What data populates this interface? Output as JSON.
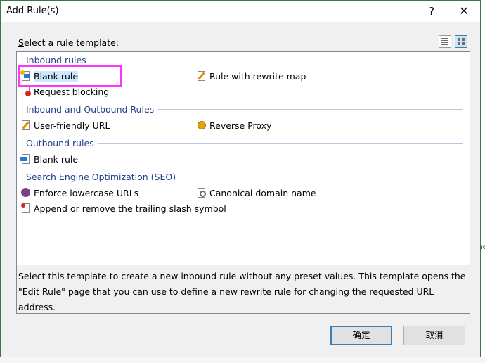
{
  "window": {
    "title": "Add Rule(s)",
    "help_glyph": "?",
    "close_glyph": "✕"
  },
  "select_label": {
    "mnemonic": "S",
    "rest": "elect a rule template:"
  },
  "groups": {
    "inbound": "Inbound rules",
    "inout": "Inbound and Outbound Rules",
    "outbound": "Outbound rules",
    "seo": "Search Engine Optimization (SEO)"
  },
  "items": {
    "blank_inbound": "Blank rule",
    "rewrite_map": "Rule with rewrite map",
    "request_blocking": "Request blocking",
    "user_friendly_url": "User-friendly URL",
    "reverse_proxy": "Reverse Proxy",
    "blank_outbound": "Blank rule",
    "lowercase": "Enforce lowercase URLs",
    "canonical": "Canonical domain name",
    "trailing_slash": "Append or remove the trailing slash symbol"
  },
  "selected_item": "blank_inbound",
  "description": "Select this template to create a new inbound rule without any preset values. This template opens the \"Edit Rule\" page that you can use to define a new rewrite rule for changing the requested URL address.",
  "buttons": {
    "ok": "确定",
    "cancel": "取消"
  },
  "colors": {
    "group_header": "#1f3f8a",
    "highlight": "#ff33ff",
    "selection": "#cce8ff",
    "border": "#2d7d46"
  },
  "background_mark": "ıe"
}
